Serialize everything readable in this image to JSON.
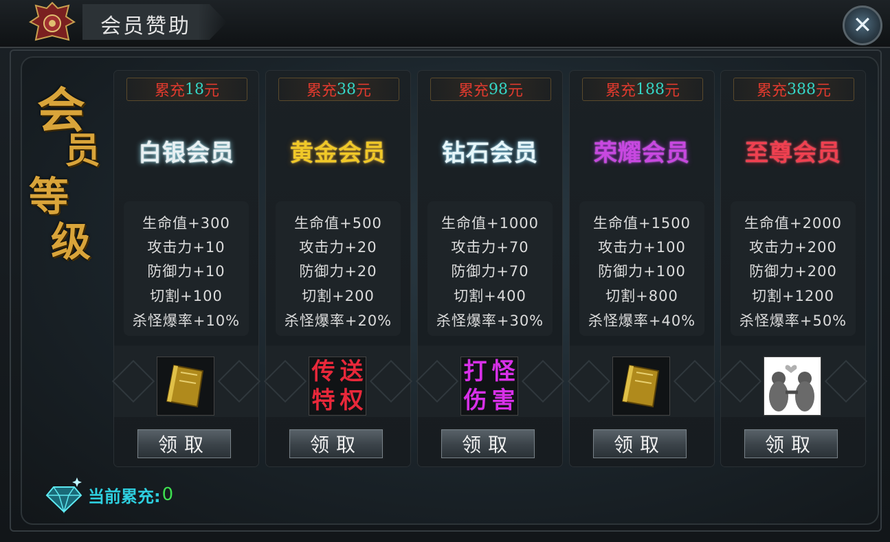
{
  "window": {
    "title": "会员赞助"
  },
  "sidebar_title": {
    "chars": [
      "会",
      "员",
      "等",
      "级"
    ]
  },
  "tiers": [
    {
      "price_label": "累充",
      "price_value": "18",
      "price_unit": "元",
      "name": "白银会员",
      "name_color": "#e8f0f2",
      "stats": [
        "生命值+300",
        "攻击力+10",
        "防御力+10",
        "切割+100",
        "杀怪爆率+10%"
      ],
      "reward_icon": "golden-book-icon",
      "claim_label": "领取"
    },
    {
      "price_label": "累充",
      "price_value": "38",
      "price_unit": "元",
      "name": "黄金会员",
      "name_color": "#f0c828",
      "stats": [
        "生命值+500",
        "攻击力+20",
        "防御力+20",
        "切割+200",
        "杀怪爆率+20%"
      ],
      "reward_text": [
        "传",
        "送",
        "特",
        "权"
      ],
      "reward_color": "#e8283a",
      "claim_label": "领取"
    },
    {
      "price_label": "累充",
      "price_value": "98",
      "price_unit": "元",
      "name": "钻石会员",
      "name_color": "#e6f6fa",
      "stats": [
        "生命值+1000",
        "攻击力+70",
        "防御力+70",
        "切割+400",
        "杀怪爆率+30%"
      ],
      "reward_text": [
        "打",
        "怪",
        "伤",
        "害"
      ],
      "reward_color": "#d830e8",
      "claim_label": "领取"
    },
    {
      "price_label": "累充",
      "price_value": "188",
      "price_unit": "元",
      "name": "荣耀会员",
      "name_color": "#c848e0",
      "stats": [
        "生命值+1500",
        "攻击力+100",
        "防御力+100",
        "切割+800",
        "杀怪爆率+40%"
      ],
      "reward_icon": "golden-book-icon",
      "claim_label": "领取"
    },
    {
      "price_label": "累充",
      "price_value": "388",
      "price_unit": "元",
      "name": "至尊会员",
      "name_color": "#f04050",
      "stats": [
        "生命值+2000",
        "攻击力+200",
        "防御力+200",
        "切割+1200",
        "杀怪爆率+50%"
      ],
      "reward_icon": "bear-couple-icon",
      "claim_label": "领取"
    }
  ],
  "footer": {
    "current_label": "当前累充:",
    "current_value": "0"
  }
}
